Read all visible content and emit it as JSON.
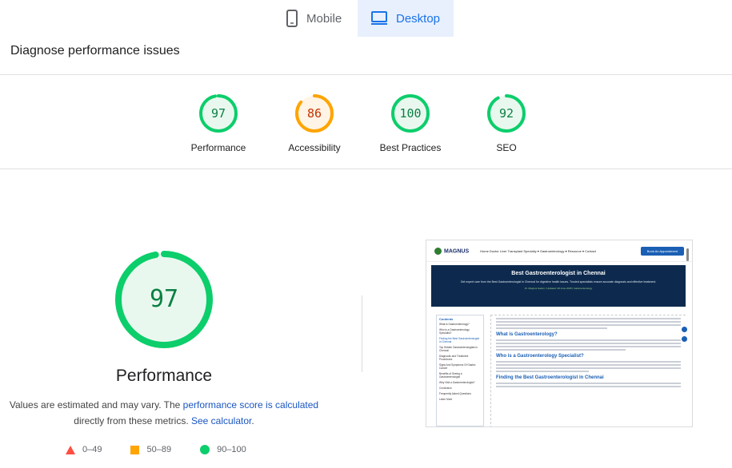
{
  "tabs": [
    {
      "label": "Mobile",
      "icon": "smartphone-icon",
      "selected": false
    },
    {
      "label": "Desktop",
      "icon": "desktop-icon",
      "selected": true
    }
  ],
  "diagnose_title": "Diagnose performance issues",
  "scores": [
    {
      "label": "Performance",
      "value": "97",
      "score": 0.97,
      "color": "#0cce6b"
    },
    {
      "label": "Accessibility",
      "value": "86",
      "score": 0.86,
      "color": "#ffa400"
    },
    {
      "label": "Best Practices",
      "value": "100",
      "score": 1.0,
      "color": "#0cce6b"
    },
    {
      "label": "SEO",
      "value": "92",
      "score": 0.92,
      "color": "#0cce6b"
    }
  ],
  "main_gauge": {
    "label": "Performance",
    "value": "97",
    "score": 0.97,
    "color": "#0cce6b"
  },
  "note": {
    "prefix": "Values are estimated and may vary. The ",
    "link1": "performance score is calculated",
    "middle": "directly from these metrics. ",
    "link2": "See calculator",
    "suffix": "."
  },
  "legend": [
    {
      "shape": "triangle",
      "range": "0–49",
      "color": "#ff4e42"
    },
    {
      "shape": "square",
      "range": "50–89",
      "color": "#ffa400"
    },
    {
      "shape": "circle",
      "range": "90–100",
      "color": "#0cce6b"
    }
  ],
  "screenshot": {
    "logo": "MAGNUS",
    "menu": "Home   Doctor   Liver Transplant   Specialty ▾   Gastroenterology ▾   Resource ▾   Contact",
    "cta": "Book An Appointment",
    "hero_title": "Best Gastroenterologist in Chennai",
    "hero_sub": "Get expert care from the Best Gastroenterologist in Chennai for digestive health issues. Trusted specialists ensure accurate diagnosis and effective treatment.",
    "hero_meta": "Dr. Magnus Gastro   |   Updated: 28 June 2025   |   Gastroenterology",
    "toc_title": "Contents",
    "toc_items": [
      "What is Gastroenterology?",
      "Who is a Gastroenterology Specialist?",
      "Finding the Best Gastroenterologist in Chennai",
      "Top Hidden Gastroenterologists in Chennai",
      "Diagnostic and Treatment Procedures",
      "Signs And Symptoms Of Gastric Cancer",
      "Benefits of Seeing a Gastroenterologist",
      "Why Visit a Gastroenterologist?",
      "Conclusion",
      "Frequently Asked Questions",
      "Learn More"
    ],
    "headings": [
      "What is Gastroenterology?",
      "Who is a Gastroenterology Specialist?",
      "Finding the Best Gastroenterologist in Chennai"
    ]
  }
}
